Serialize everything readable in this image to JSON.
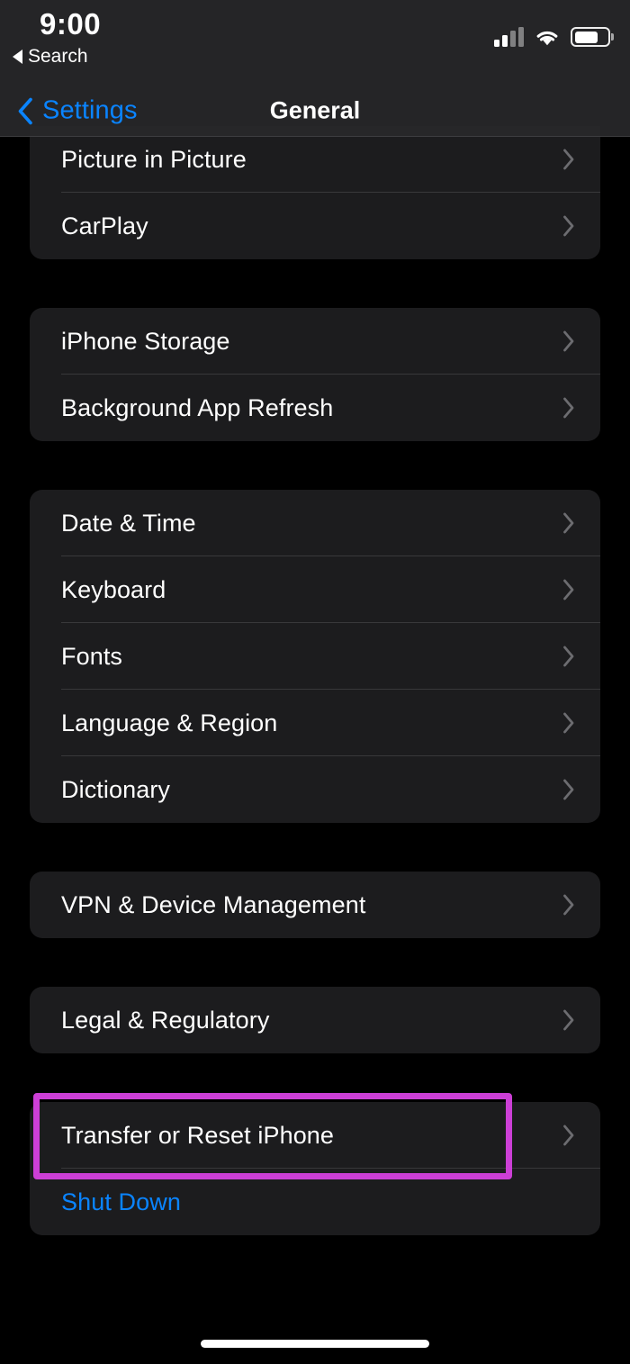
{
  "status_bar": {
    "time": "9:00",
    "back_to_app_label": "Search",
    "back_to_app_icon": "triangle-left-icon",
    "cellular_icon": "cellular-signal-icon",
    "cellular_bars_filled": 2,
    "cellular_bars_total": 4,
    "wifi_icon": "wifi-icon",
    "battery_icon": "battery-icon",
    "battery_level_percent": 72
  },
  "nav_bar": {
    "back_label": "Settings",
    "back_icon": "chevron-left-icon",
    "title": "General"
  },
  "colors": {
    "accent_blue": "#0A84FF",
    "highlight_magenta": "#CC3FD6",
    "card_background": "#1C1C1E",
    "page_background": "#000000",
    "separator": "#38383A",
    "chevron_gray": "#6C6C70"
  },
  "groups": [
    {
      "name": "display-group",
      "clipped_top": true,
      "rows": [
        {
          "label": "Picture in Picture",
          "accessory": "chevron-right-icon",
          "style": "default"
        },
        {
          "label": "CarPlay",
          "accessory": "chevron-right-icon",
          "style": "default"
        }
      ]
    },
    {
      "name": "storage-group",
      "clipped_top": false,
      "rows": [
        {
          "label": "iPhone Storage",
          "accessory": "chevron-right-icon",
          "style": "default"
        },
        {
          "label": "Background App Refresh",
          "accessory": "chevron-right-icon",
          "style": "default"
        }
      ]
    },
    {
      "name": "localization-group",
      "clipped_top": false,
      "rows": [
        {
          "label": "Date & Time",
          "accessory": "chevron-right-icon",
          "style": "default"
        },
        {
          "label": "Keyboard",
          "accessory": "chevron-right-icon",
          "style": "default"
        },
        {
          "label": "Fonts",
          "accessory": "chevron-right-icon",
          "style": "default"
        },
        {
          "label": "Language & Region",
          "accessory": "chevron-right-icon",
          "style": "default"
        },
        {
          "label": "Dictionary",
          "accessory": "chevron-right-icon",
          "style": "default"
        }
      ]
    },
    {
      "name": "vpn-group",
      "clipped_top": false,
      "rows": [
        {
          "label": "VPN & Device Management",
          "accessory": "chevron-right-icon",
          "style": "default"
        }
      ]
    },
    {
      "name": "legal-group",
      "clipped_top": false,
      "rows": [
        {
          "label": "Legal & Regulatory",
          "accessory": "chevron-right-icon",
          "style": "default"
        }
      ]
    },
    {
      "name": "reset-group",
      "clipped_top": false,
      "rows": [
        {
          "label": "Transfer or Reset iPhone",
          "accessory": "chevron-right-icon",
          "style": "default",
          "highlighted": true
        },
        {
          "label": "Shut Down",
          "accessory": "none",
          "style": "accent"
        }
      ]
    }
  ],
  "home_indicator": "home-indicator"
}
